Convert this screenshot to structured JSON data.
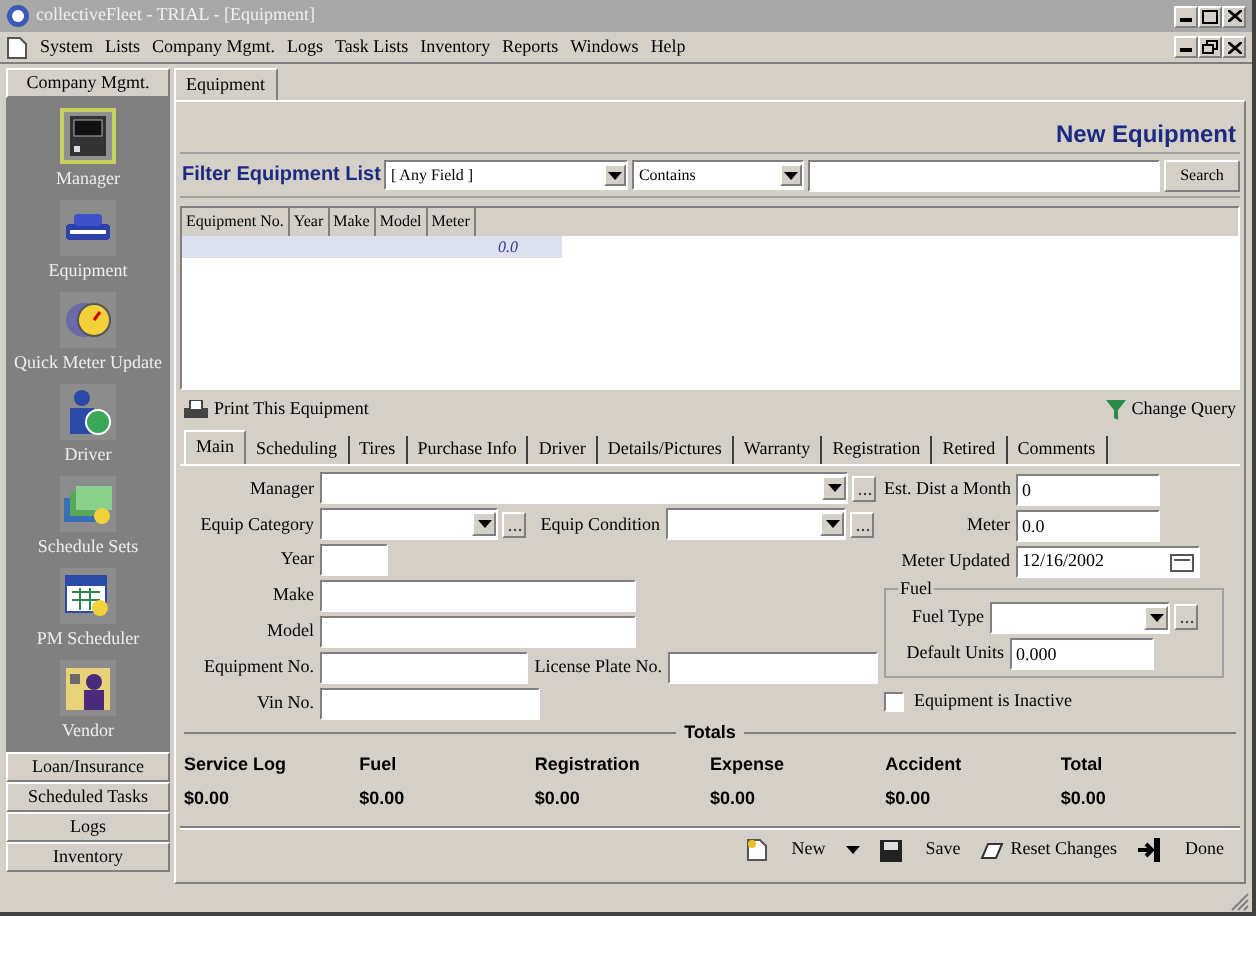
{
  "window": {
    "title": "collectiveFleet - TRIAL - [Equipment]"
  },
  "menu": [
    "System",
    "Lists",
    "Company Mgmt.",
    "Logs",
    "Task Lists",
    "Inventory",
    "Reports",
    "Windows",
    "Help"
  ],
  "sidebar": {
    "header": "Company Mgmt.",
    "items": [
      {
        "label": "Manager",
        "kind": "monitor",
        "selected": true
      },
      {
        "label": "Equipment",
        "kind": "car",
        "selected": false
      },
      {
        "label": "Quick Meter Update",
        "kind": "meter",
        "selected": false
      },
      {
        "label": "Driver",
        "kind": "person",
        "selected": false
      },
      {
        "label": "Schedule Sets",
        "kind": "stack",
        "selected": false
      },
      {
        "label": "PM Scheduler",
        "kind": "calendar",
        "selected": false
      },
      {
        "label": "Vendor",
        "kind": "building",
        "selected": false
      }
    ],
    "groups": [
      "Loan/Insurance",
      "Scheduled Tasks",
      "Logs",
      "Inventory"
    ]
  },
  "document_tab": "Equipment",
  "header_title": "New Equipment",
  "filter": {
    "label": "Filter Equipment List",
    "field": "[ Any Field ]",
    "operator": "Contains",
    "button": "Search"
  },
  "table": {
    "columns": [
      "Equipment No.",
      "Year",
      "Make",
      "Model",
      "Meter"
    ],
    "new_row_meter": "0.0"
  },
  "print_link": "Print This Equipment",
  "change_query": "Change Query",
  "tabs": [
    {
      "label": "Main",
      "selected": true
    },
    {
      "label": "Scheduling",
      "selected": false
    },
    {
      "label": "Tires",
      "selected": false
    },
    {
      "label": "Purchase Info",
      "selected": false
    },
    {
      "label": "Driver",
      "selected": false
    },
    {
      "label": "Details/Pictures",
      "selected": false
    },
    {
      "label": "Warranty",
      "selected": false
    },
    {
      "label": "Registration",
      "selected": false
    },
    {
      "label": "Retired",
      "selected": false
    },
    {
      "label": "Comments",
      "selected": false
    }
  ],
  "form": {
    "manager": "Manager",
    "equip_category": "Equip Category",
    "equip_condition": "Equip Condition",
    "year": "Year",
    "make": "Make",
    "model": "Model",
    "equipment_no": "Equipment No.",
    "license_plate": "License Plate No.",
    "vin": "Vin No.",
    "est_dist": {
      "label": "Est. Dist a Month",
      "value": "0"
    },
    "meter": {
      "label": "Meter",
      "value": "0.0"
    },
    "meter_updated": {
      "label": "Meter Updated",
      "value": "12/16/2002"
    },
    "fuel": {
      "title": "Fuel",
      "fuel_type": "Fuel Type",
      "default_units": {
        "label": "Default Units",
        "value": "0.000"
      }
    },
    "inactive": {
      "label": "Equipment is Inactive",
      "checked": false
    }
  },
  "totals": {
    "title": "Totals",
    "items": [
      {
        "label": "Service Log",
        "value": "$0.00"
      },
      {
        "label": "Fuel",
        "value": "$0.00"
      },
      {
        "label": "Registration",
        "value": "$0.00"
      },
      {
        "label": "Expense",
        "value": "$0.00"
      },
      {
        "label": "Accident",
        "value": "$0.00"
      },
      {
        "label": "Total",
        "value": "$0.00"
      }
    ]
  },
  "toolbar": {
    "new": "New",
    "save": "Save",
    "reset": "Reset Changes",
    "done": "Done"
  }
}
